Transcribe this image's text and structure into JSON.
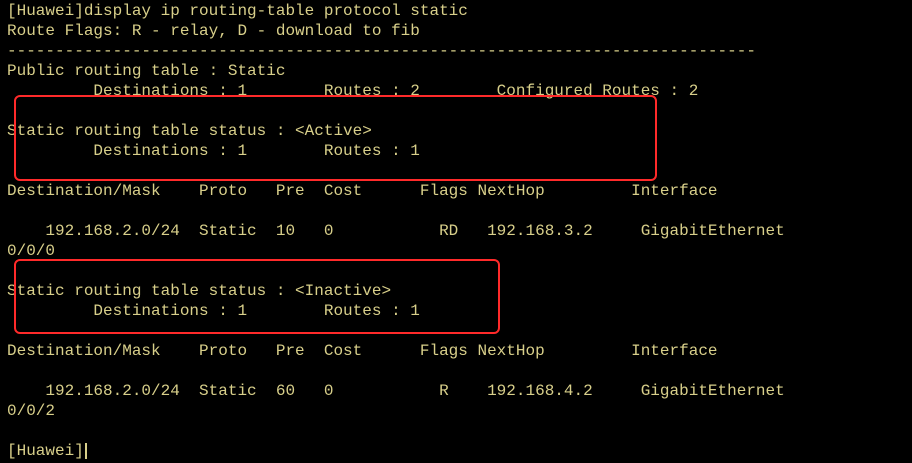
{
  "terminal": {
    "lines": [
      "[Huawei]display ip routing-table protocol static",
      "Route Flags: R - relay, D - download to fib",
      "------------------------------------------------------------------------------",
      "Public routing table : Static",
      "         Destinations : 1        Routes : 2        Configured Routes : 2",
      "",
      "Static routing table status : <Active>",
      "         Destinations : 1        Routes : 1",
      "",
      "Destination/Mask    Proto   Pre  Cost      Flags NextHop         Interface",
      "",
      "    192.168.2.0/24  Static  10   0           RD   192.168.3.2     GigabitEthernet",
      "0/0/0",
      "",
      "Static routing table status : <Inactive>",
      "         Destinations : 1        Routes : 1",
      "",
      "Destination/Mask    Proto   Pre  Cost      Flags NextHop         Interface",
      "",
      "    192.168.2.0/24  Static  60   0           R    192.168.4.2     GigabitEthernet",
      "0/0/2",
      "",
      "[Huawei]"
    ]
  },
  "colors": {
    "background": "#000000",
    "text": "#d8cf8a",
    "highlight": "#ff2a2a"
  }
}
